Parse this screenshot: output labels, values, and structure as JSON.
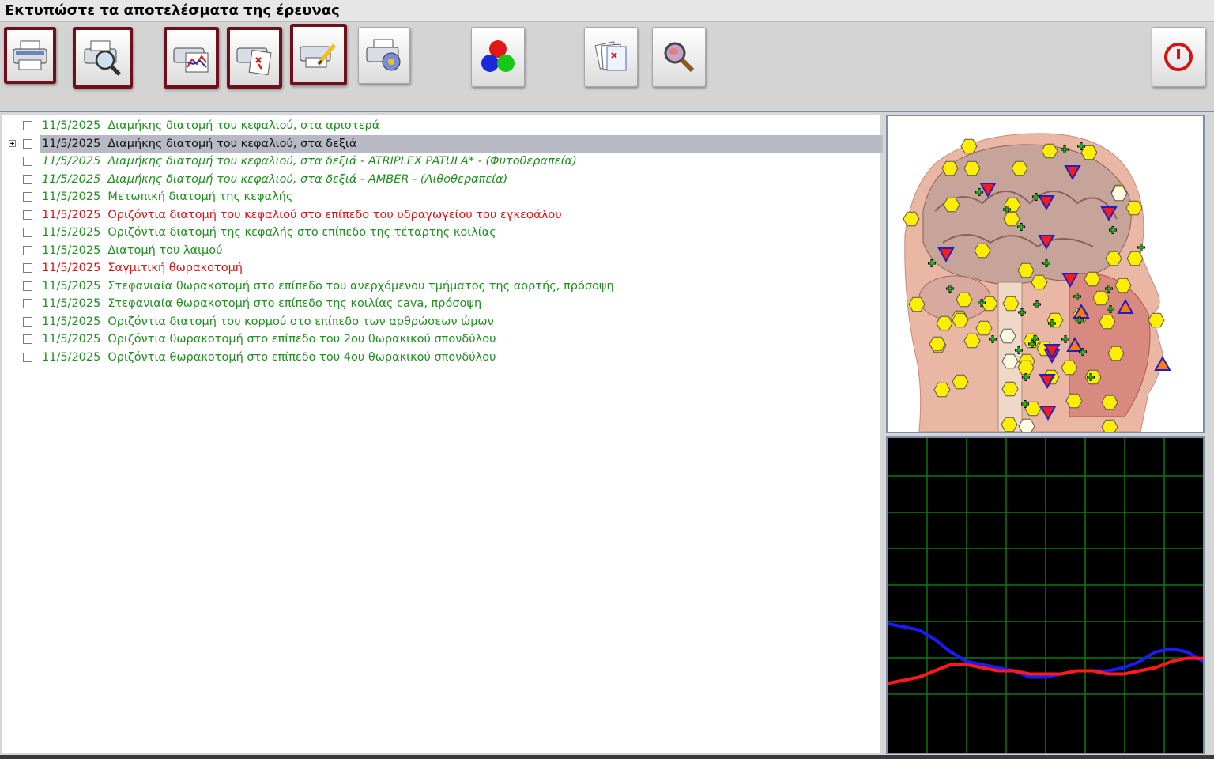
{
  "window": {
    "title": "Εκτυπώστε τα αποτελέσματα της έρευνας"
  },
  "toolbar": {
    "buttons": [
      {
        "name": "print-button",
        "icon": "printer-icon",
        "highlighted": true
      },
      {
        "name": "print-preview-button",
        "icon": "print-preview-magnifier-icon",
        "highlighted": true
      },
      {
        "name": "print-chart-button",
        "icon": "printer-chart-icon",
        "highlighted": true
      },
      {
        "name": "print-remedies-button",
        "icon": "printer-remedies-icon",
        "highlighted": true
      },
      {
        "name": "print-edit-button",
        "icon": "printer-pen-icon",
        "highlighted": true
      },
      {
        "name": "print-extra-button",
        "icon": "printer-disc-icon",
        "highlighted": false
      },
      {
        "name": "color-model-button",
        "icon": "rgb-spheres-icon",
        "highlighted": false
      },
      {
        "name": "reports-button",
        "icon": "documents-icon",
        "highlighted": false
      },
      {
        "name": "zoom-button",
        "icon": "magnifier-icon",
        "highlighted": false
      },
      {
        "name": "exit-button",
        "icon": "power-icon",
        "highlighted": false
      }
    ]
  },
  "colors": {
    "green": "#1f8f1f",
    "red": "#e01010",
    "highlight_border": "#6e0f1a",
    "graph_blue": "#1a1aff",
    "graph_red": "#ff1a1a",
    "grid": "#0a7a0a"
  },
  "results": [
    {
      "date": "11/5/2025",
      "label": "Διαμήκης διατομή του κεφαλιού, στα αριστερά",
      "color": "green",
      "italic": false,
      "expander": false,
      "selected": false
    },
    {
      "date": "11/5/2025",
      "label": "Διαμήκης διατομή του κεφαλιού, στα δεξιά",
      "color": "black",
      "italic": false,
      "expander": true,
      "selected": true
    },
    {
      "date": "11/5/2025",
      "label": "Διαμήκης διατομή του κεφαλιού, στα δεξιά - ATRIPLEX  PATULA* - (Φυτοθεραπεία)",
      "color": "green",
      "italic": true,
      "expander": false,
      "selected": false
    },
    {
      "date": "11/5/2025",
      "label": "Διαμήκης διατομή του κεφαλιού, στα δεξιά - AMBER - (Λιθοθεραπεία)",
      "color": "green",
      "italic": true,
      "expander": false,
      "selected": false
    },
    {
      "date": "11/5/2025",
      "label": "Μετωπική διατομή της κεφαλής",
      "color": "green",
      "italic": false,
      "expander": false,
      "selected": false
    },
    {
      "date": "11/5/2025",
      "label": "Οριζόντια διατομή του κεφαλιού στο επίπεδο του υδραγωγείου του εγκεφάλου",
      "color": "red",
      "italic": false,
      "expander": false,
      "selected": false
    },
    {
      "date": "11/5/2025",
      "label": "Οριζόντια διατομή της κεφαλής στο επίπεδο της τέταρτης κοιλίας",
      "color": "green",
      "italic": false,
      "expander": false,
      "selected": false
    },
    {
      "date": "11/5/2025",
      "label": "Διατομή του λαιμού",
      "color": "green",
      "italic": false,
      "expander": false,
      "selected": false
    },
    {
      "date": "11/5/2025",
      "label": "Σαγμιτική θωρακοτομή",
      "color": "red",
      "italic": false,
      "expander": false,
      "selected": false
    },
    {
      "date": "11/5/2025",
      "label": "Στεφανιαία θωρακοτομή στο επίπεδο του ανερχόμενου τμήματος της αορτής, πρόσοψη",
      "color": "green",
      "italic": false,
      "expander": false,
      "selected": false
    },
    {
      "date": "11/5/2025",
      "label": "Στεφανιαία θωρακοτομή στο επίπεδο της κοιλίας cava, πρόσοψη",
      "color": "green",
      "italic": false,
      "expander": false,
      "selected": false
    },
    {
      "date": "11/5/2025",
      "label": "Οριζόντια διατομή του κορμού στο επίπεδο των αρθρώσεων ώμων",
      "color": "green",
      "italic": false,
      "expander": false,
      "selected": false
    },
    {
      "date": "11/5/2025",
      "label": "Οριζόντια θωρακοτομή στο επίπεδο του 2ου θωρακικού σπονδύλου",
      "color": "green",
      "italic": false,
      "expander": false,
      "selected": false
    },
    {
      "date": "11/5/2025",
      "label": "Οριζόντια θωρακοτομή στο επίπεδο του 4ου θωρακικού σπονδύλου",
      "color": "green",
      "italic": false,
      "expander": false,
      "selected": false
    }
  ],
  "chart_data": {
    "type": "line",
    "grid": true,
    "x": [
      0,
      1,
      2,
      3,
      4,
      5,
      6,
      7,
      8,
      9,
      10,
      11,
      12,
      13,
      14,
      15,
      16,
      17,
      18,
      19,
      20
    ],
    "series": [
      {
        "color": "#1a1aff",
        "values": [
          0.41,
          0.4,
          0.39,
          0.36,
          0.32,
          0.29,
          0.28,
          0.27,
          0.26,
          0.24,
          0.24,
          0.25,
          0.26,
          0.26,
          0.26,
          0.27,
          0.29,
          0.32,
          0.33,
          0.32,
          0.29
        ]
      },
      {
        "color": "#ff1a1a",
        "values": [
          0.22,
          0.23,
          0.24,
          0.26,
          0.28,
          0.28,
          0.27,
          0.26,
          0.26,
          0.25,
          0.25,
          0.25,
          0.26,
          0.26,
          0.25,
          0.25,
          0.26,
          0.27,
          0.29,
          0.3,
          0.3
        ]
      }
    ],
    "xlim": [
      0,
      20
    ],
    "ylim": [
      0,
      1
    ]
  }
}
